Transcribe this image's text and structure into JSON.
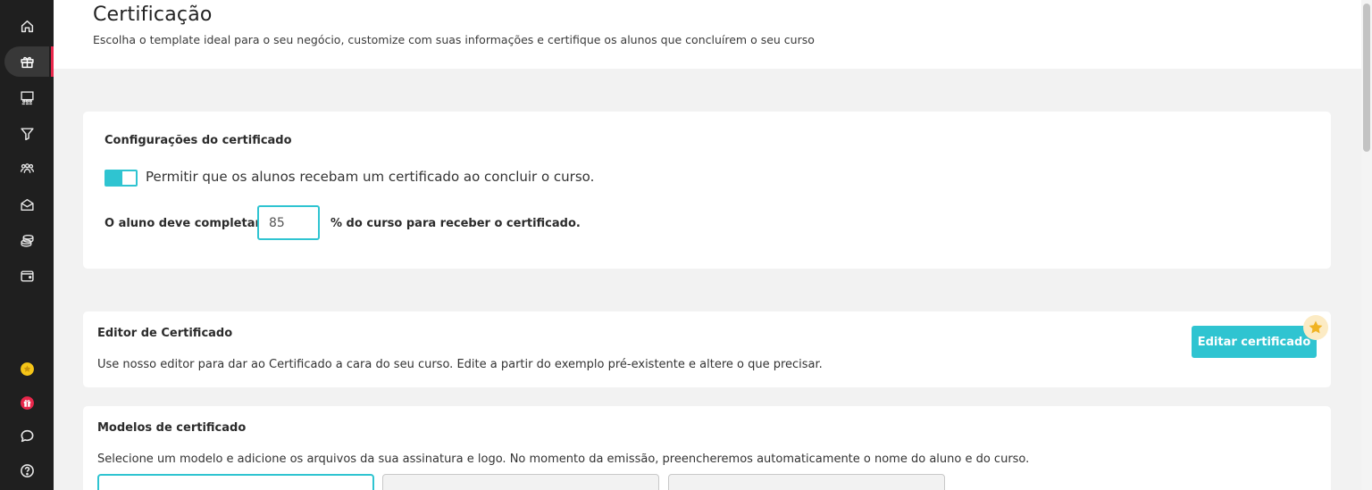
{
  "header": {
    "title": "Certificação",
    "subtitle": "Escolha o template ideal para o seu negócio, customize com suas informações e certifique os alunos que concluírem o seu curso"
  },
  "sidebar": {
    "items": [
      {
        "icon": "home-icon"
      },
      {
        "icon": "gift-icon",
        "active": true
      },
      {
        "icon": "courses-icon"
      },
      {
        "icon": "funnel-icon"
      },
      {
        "icon": "users-icon"
      },
      {
        "icon": "mail-icon"
      },
      {
        "icon": "coins-icon"
      },
      {
        "icon": "wallet-icon"
      }
    ],
    "bottom_items": [
      {
        "icon": "star-coin-icon",
        "color": "#f5c518"
      },
      {
        "icon": "gift-badge-icon",
        "color": "#e8274b"
      },
      {
        "icon": "chat-icon"
      },
      {
        "icon": "help-icon"
      }
    ],
    "active_color": "#e8274b"
  },
  "certificate_config": {
    "title": "Configurações do certificado",
    "toggle_label": "Permitir que os alunos recebam um certificado ao concluir o curso.",
    "toggle_on": true,
    "complete_label": "O aluno deve completar",
    "percent_value": "85",
    "percent_label": "% do curso para receber o certificado."
  },
  "editor": {
    "title": "Editor de Certificado",
    "description": "Use nosso editor para dar ao Certificado a cara do seu curso. Edite a partir do exemplo pré-existente e altere o que precisar.",
    "button_label": "Editar certificado",
    "badge_icon": "star-icon"
  },
  "models": {
    "title": "Modelos de certificado",
    "description": "Selecione um modelo e adicione os arquivos da sua assinatura e logo. No momento da emissão, preencheremos automaticamente o nome do aluno e do curso.",
    "templates": [
      {
        "selected": true
      },
      {
        "selected": false
      },
      {
        "selected": false
      }
    ]
  },
  "colors": {
    "accent": "#2fc4d1",
    "sidebar_bg": "#1f1f1f",
    "page_bg": "#f2f2f2"
  }
}
